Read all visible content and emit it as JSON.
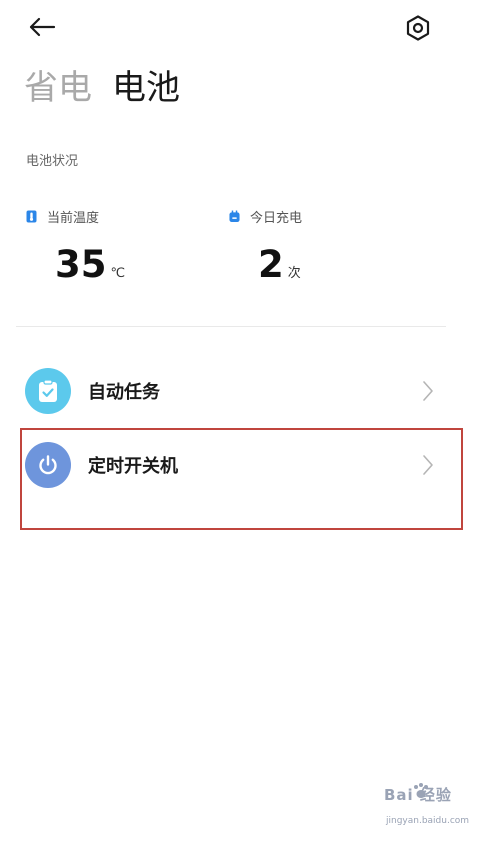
{
  "header": {
    "back_icon": "back-arrow-icon",
    "settings_icon": "settings-hexagon-icon"
  },
  "tabs": [
    {
      "label": "省电",
      "active": false
    },
    {
      "label": "电池",
      "active": true
    }
  ],
  "battery_status": {
    "section_label": "电池状况",
    "temperature": {
      "label": "当前温度",
      "value": "35",
      "unit": "℃",
      "icon": "thermometer-icon",
      "icon_color": "#2b86e8"
    },
    "charges_today": {
      "label": "今日充电",
      "value": "2",
      "unit": "次",
      "icon": "battery-icon",
      "icon_color": "#2b86e8"
    }
  },
  "menu": {
    "items": [
      {
        "label": "自动任务",
        "icon": "clipboard-check-icon",
        "color": "#5cc9ec"
      },
      {
        "label": "定时开关机",
        "icon": "power-icon",
        "color": "#6e95dc"
      }
    ]
  },
  "highlight_color": "#c0453e",
  "watermark": {
    "text": "Bai 经验",
    "url": "jingyan.baidu.com"
  }
}
